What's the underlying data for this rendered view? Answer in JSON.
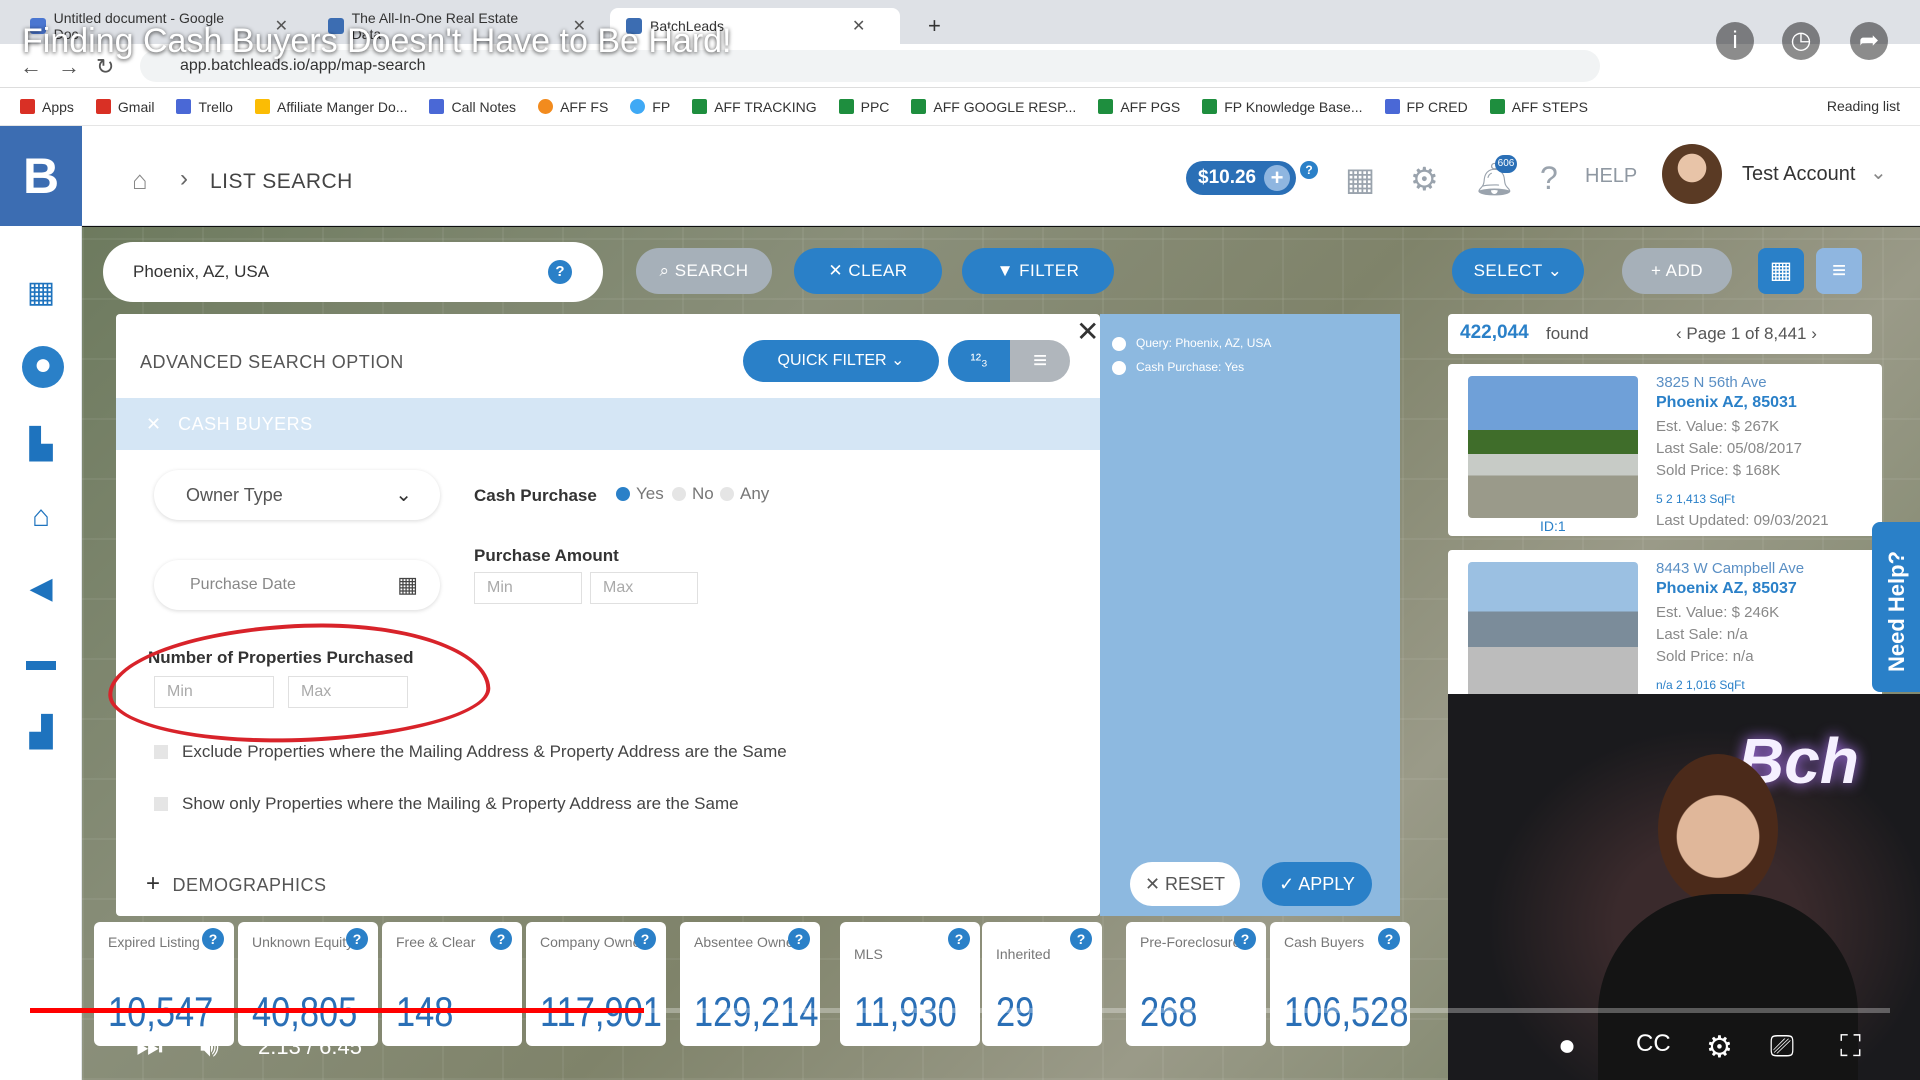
{
  "browser": {
    "tabs": [
      {
        "label": "Untitled document - Google Doc"
      },
      {
        "label": "The All-In-One Real Estate Data"
      },
      {
        "label": "BatchLeads"
      }
    ],
    "url": "app.batchleads.io/app/map-search",
    "bookmarks": [
      {
        "label": "Apps",
        "icon": "apps-grid-icon"
      },
      {
        "label": "Gmail",
        "icon": "gmail-icon"
      },
      {
        "label": "Trello",
        "icon": "trello-icon"
      },
      {
        "label": "Affiliate Manger Do...",
        "icon": "drive-icon"
      },
      {
        "label": "Call Notes",
        "icon": "docs-icon"
      },
      {
        "label": "AFF FS",
        "icon": "fs-icon"
      },
      {
        "label": "FP",
        "icon": "fp-icon"
      },
      {
        "label": "AFF TRACKING",
        "icon": "sheets-icon"
      },
      {
        "label": "PPC",
        "icon": "sheets-icon"
      },
      {
        "label": "AFF GOOGLE RESP...",
        "icon": "sheets-icon"
      },
      {
        "label": "AFF PGS",
        "icon": "sheets-icon"
      },
      {
        "label": "FP Knowledge Base...",
        "icon": "sheets-icon"
      },
      {
        "label": "FP CRED",
        "icon": "docs-icon"
      },
      {
        "label": "AFF STEPS",
        "icon": "sheets-icon"
      }
    ],
    "reading_list": "Reading list"
  },
  "video": {
    "title": "Finding Cash Buyers Doesn't Have to Be Hard!",
    "time": "2:13 / 6:45",
    "progress": 0.33
  },
  "header": {
    "breadcrumb": "LIST SEARCH",
    "credits": "$10.26",
    "notification_count": "606",
    "help": "HELP",
    "account": "Test Account"
  },
  "map": {
    "location": "Phoenix, AZ, USA",
    "search_label": "SEARCH",
    "clear_label": "CLEAR",
    "filter_label": "FILTER",
    "select_label": "SELECT",
    "add_label": "ADD"
  },
  "advanced": {
    "title": "ADVANCED SEARCH OPTION",
    "quick_filter": "QUICK FILTER",
    "section": "CASH BUYERS",
    "owner_type": "Owner Type",
    "cash_purchase_label": "Cash Purchase",
    "cash_options": [
      "Yes",
      "No",
      "Any"
    ],
    "purchase_date": "Purchase Date",
    "purchase_amount_label": "Purchase Amount",
    "min": "Min",
    "max": "Max",
    "num_props_label": "Number of Properties Purchased",
    "exclude_label": "Exclude Properties where the Mailing Address & Property Address are the Same",
    "showonly_label": "Show only Properties where the Mailing & Property Address are the Same",
    "demographics": "DEMOGRAPHICS"
  },
  "query": {
    "line1": "Query: Phoenix, AZ, USA",
    "line2": "Cash Purchase: Yes",
    "reset": "RESET",
    "apply": "APPLY"
  },
  "results": {
    "count": "422,044",
    "found_label": "found",
    "page_label": "Page",
    "page": "1",
    "of_pages": "of 8,441",
    "cards": [
      {
        "address": "3825 N 56th Ave",
        "city": "Phoenix AZ, 85031",
        "est_value": "Est. Value: $ 267K",
        "last_sale": "Last Sale: 05/08/2017",
        "sold_price": "Sold Price: $ 168K",
        "features": "5   2   1,413 SqFt",
        "last_updated": "Last Updated: 09/03/2021",
        "id": "ID:1"
      },
      {
        "address": "8443 W Campbell Ave",
        "city": "Phoenix AZ, 85037",
        "est_value": "Est. Value: $ 246K",
        "last_sale": "Last Sale: n/a",
        "sold_price": "Sold Price: n/a",
        "features": "n/a   2   1,016 SqFt"
      }
    ],
    "need_help": "Need Help?"
  },
  "stats": [
    {
      "label": "Expired Listing",
      "value": "10,547"
    },
    {
      "label": "Unknown Equity",
      "value": "40,805"
    },
    {
      "label": "Free & Clear",
      "value": "148"
    },
    {
      "label": "Company Owned",
      "value": "117,901"
    },
    {
      "label": "Absentee Owners",
      "value": "129,214"
    },
    {
      "label": "MLS",
      "value": "11,930"
    },
    {
      "label": "Inherited",
      "value": "29"
    },
    {
      "label": "Pre-Foreclosures",
      "value": "268"
    },
    {
      "label": "Cash Buyers",
      "value": "106,528"
    }
  ]
}
